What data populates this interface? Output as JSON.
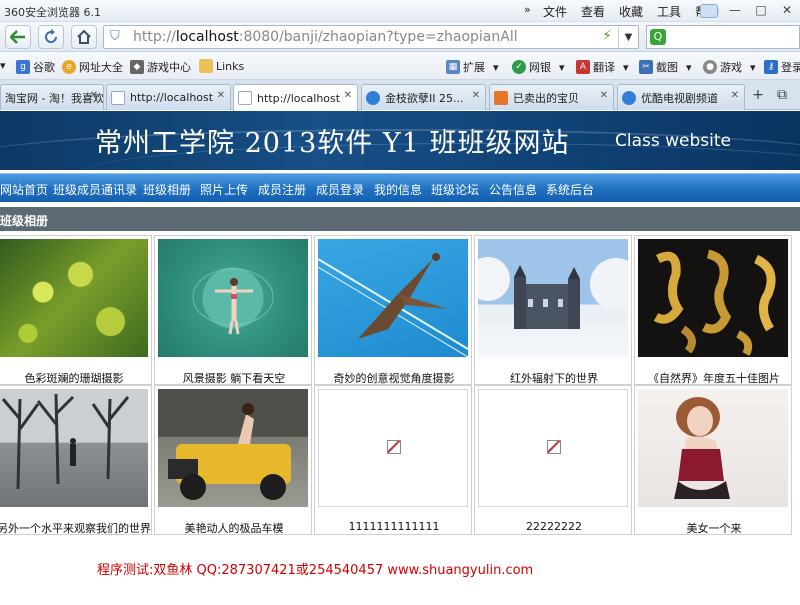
{
  "browser": {
    "title": "360安全浏览器 6.1",
    "menu": [
      "文件",
      "查看",
      "收藏",
      "工具",
      "帮助"
    ],
    "url": {
      "host_prefix": "http://",
      "host": "localhost",
      "rest": ":8080/banji/zhaopian?type=zhaopianAll"
    },
    "bookmarks": [
      "谷歌",
      "网址大全",
      "游戏中心",
      "Links"
    ],
    "tools": [
      "扩展",
      "网银",
      "翻译",
      "截图",
      "游戏",
      "登录"
    ],
    "tabs": [
      {
        "label": "淘宝网 - 淘！我喜欢"
      },
      {
        "label": "http://localhost"
      },
      {
        "label": "http://localhost"
      },
      {
        "label": "金枝欲孽II 25..."
      },
      {
        "label": "已卖出的宝贝"
      },
      {
        "label": "优酷电视剧频道"
      }
    ]
  },
  "site": {
    "title_cn": "常州工学院 2013软件 Y1 班班级网站",
    "title_en": "Class website",
    "nav": [
      "网站首页",
      "班级成员通讯录",
      "班级相册",
      "照片上传",
      "成员注册",
      "成员登录",
      "我的信息",
      "班级论坛",
      "公告信息",
      "系统后台"
    ],
    "section_title": "班级相册",
    "photos": [
      {
        "caption": "色彩斑斓的珊瑚摄影"
      },
      {
        "caption": "风景摄影 躺下看天空"
      },
      {
        "caption": "奇妙的创意视觉角度摄影"
      },
      {
        "caption": "红外辐射下的世界"
      },
      {
        "caption": "《自然界》年度五十佳图片"
      },
      {
        "caption": "另外一个水平来观察我们的世界"
      },
      {
        "caption": "美艳动人的极品车模"
      },
      {
        "caption": "1111111111111"
      },
      {
        "caption": "22222222"
      },
      {
        "caption": "美女一个来"
      }
    ],
    "footer": "程序测试:双鱼林 QQ:287307421或254540457 www.shuangyulin.com"
  }
}
